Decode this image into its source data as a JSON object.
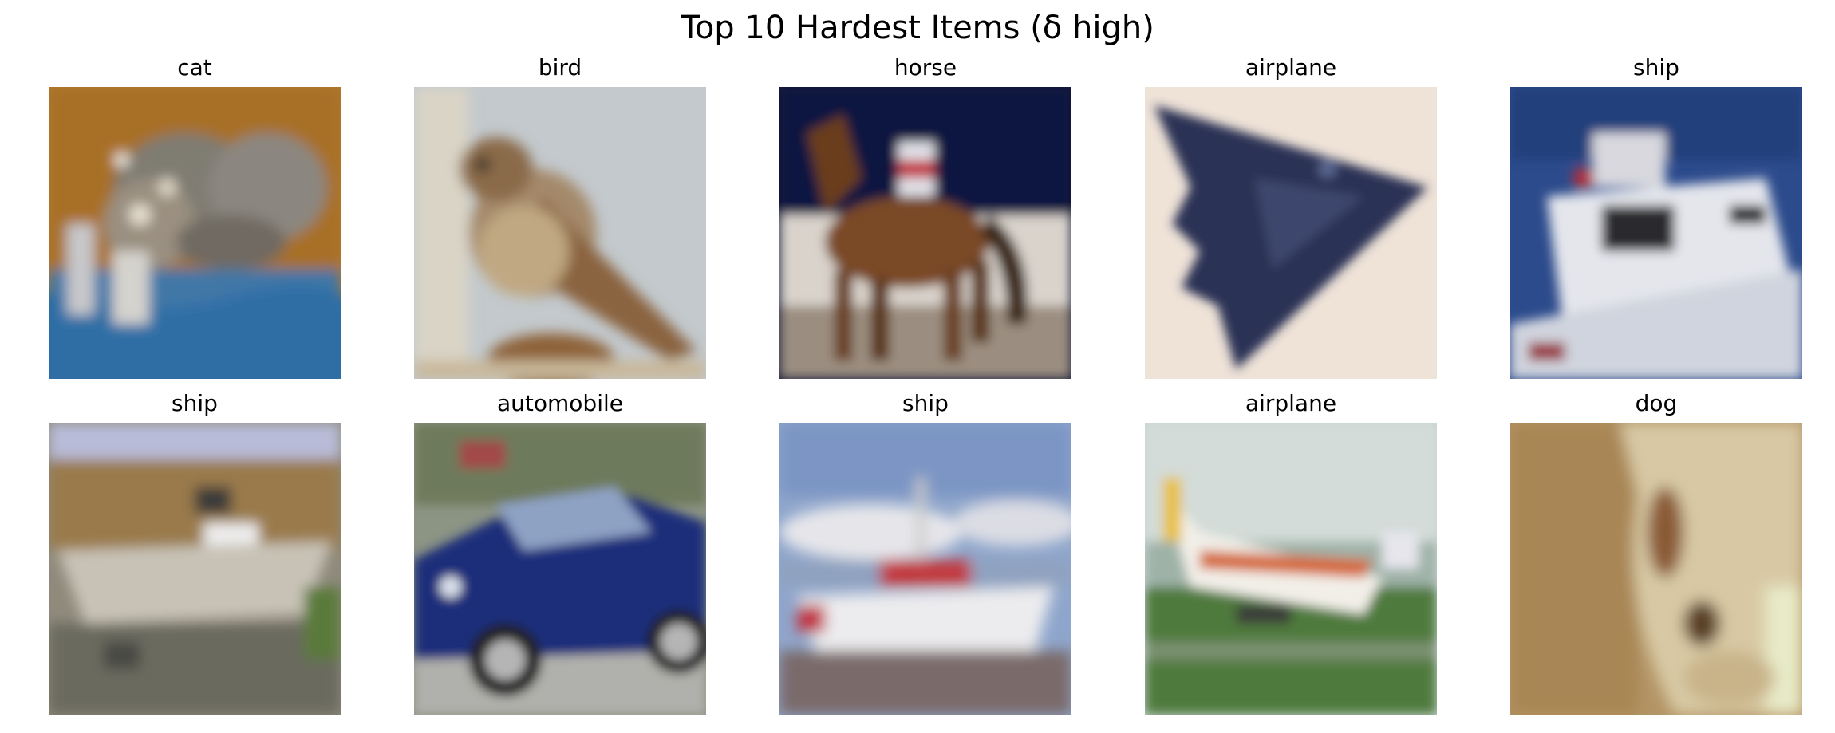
{
  "title": "Top 10 Hardest Items (δ high)",
  "items": [
    {
      "label": "cat"
    },
    {
      "label": "bird"
    },
    {
      "label": "horse"
    },
    {
      "label": "airplane"
    },
    {
      "label": "ship"
    },
    {
      "label": "ship"
    },
    {
      "label": "automobile"
    },
    {
      "label": "ship"
    },
    {
      "label": "airplane"
    },
    {
      "label": "dog"
    }
  ]
}
